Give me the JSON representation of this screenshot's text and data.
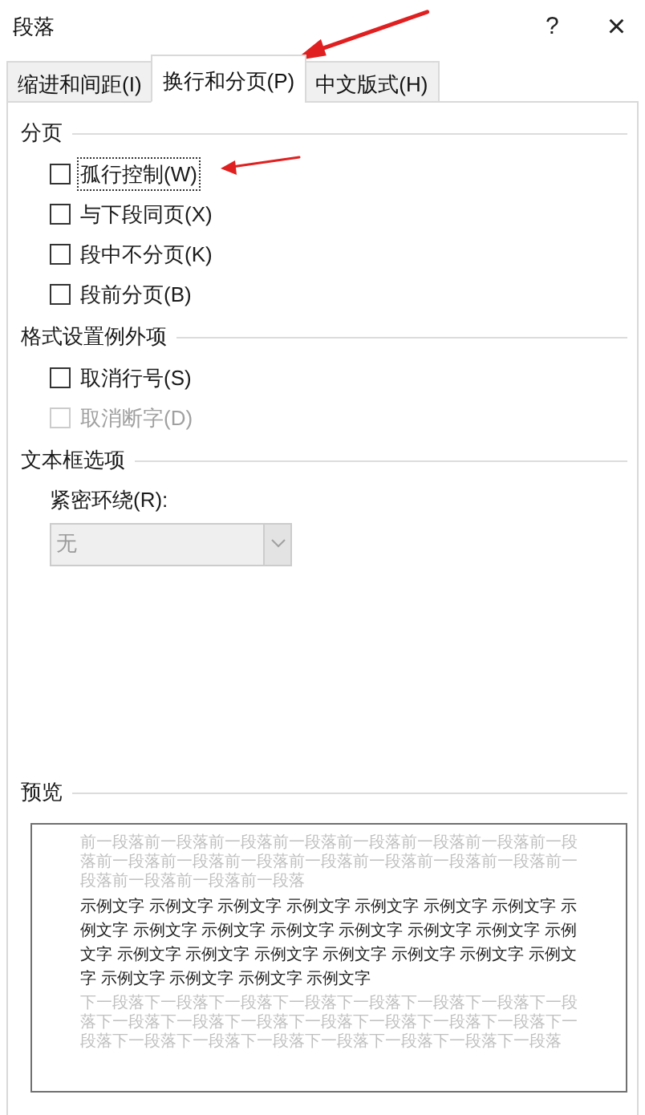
{
  "window": {
    "title": "段落",
    "help_button": "?",
    "close_button": "×"
  },
  "tabs": [
    {
      "label": "缩进和间距(I)",
      "selected": false
    },
    {
      "label": "换行和分页(P)",
      "selected": true
    },
    {
      "label": "中文版式(H)",
      "selected": false
    }
  ],
  "sections": [
    {
      "heading": "分页",
      "items": [
        {
          "kind": "checkbox",
          "label": "孤行控制(W)",
          "checked": false,
          "disabled": false,
          "focused": true
        },
        {
          "kind": "checkbox",
          "label": "与下段同页(X)",
          "checked": false,
          "disabled": false,
          "focused": false
        },
        {
          "kind": "checkbox",
          "label": "段中不分页(K)",
          "checked": false,
          "disabled": false,
          "focused": false
        },
        {
          "kind": "checkbox",
          "label": "段前分页(B)",
          "checked": false,
          "disabled": false,
          "focused": false
        }
      ]
    },
    {
      "heading": "格式设置例外项",
      "items": [
        {
          "kind": "checkbox",
          "label": "取消行号(S)",
          "checked": false,
          "disabled": false,
          "focused": false
        },
        {
          "kind": "checkbox",
          "label": "取消断字(D)",
          "checked": false,
          "disabled": true,
          "focused": false
        }
      ]
    },
    {
      "heading": "文本框选项",
      "items": [
        {
          "kind": "dropdown",
          "label": "紧密环绕(R):",
          "value": "无",
          "disabled": true
        }
      ]
    },
    {
      "heading": "预览",
      "items": [
        {
          "kind": "preview",
          "previous": "前一段落前一段落前一段落前一段落前一段落前一段落前一段落前一段落前一段落前一段落前一段落前一段落前一段落前一段落前一段落前一段落前一段落前一段落前一段落",
          "sample": "示例文字 示例文字 示例文字 示例文字 示例文字 示例文字 示例文字 示例文字 示例文字 示例文字 示例文字 示例文字 示例文字 示例文字 示例文字 示例文字 示例文字 示例文字 示例文字 示例文字 示例文字 示例文字 示例文字 示例文字 示例文字 示例文字",
          "following": "下一段落下一段落下一段落下一段落下一段落下一段落下一段落下一段落下一段落下一段落下一段落下一段落下一段落下一段落下一段落下一段落下一段落下一段落下一段落下一段落下一段落下一段落下一段落"
        }
      ]
    }
  ]
}
